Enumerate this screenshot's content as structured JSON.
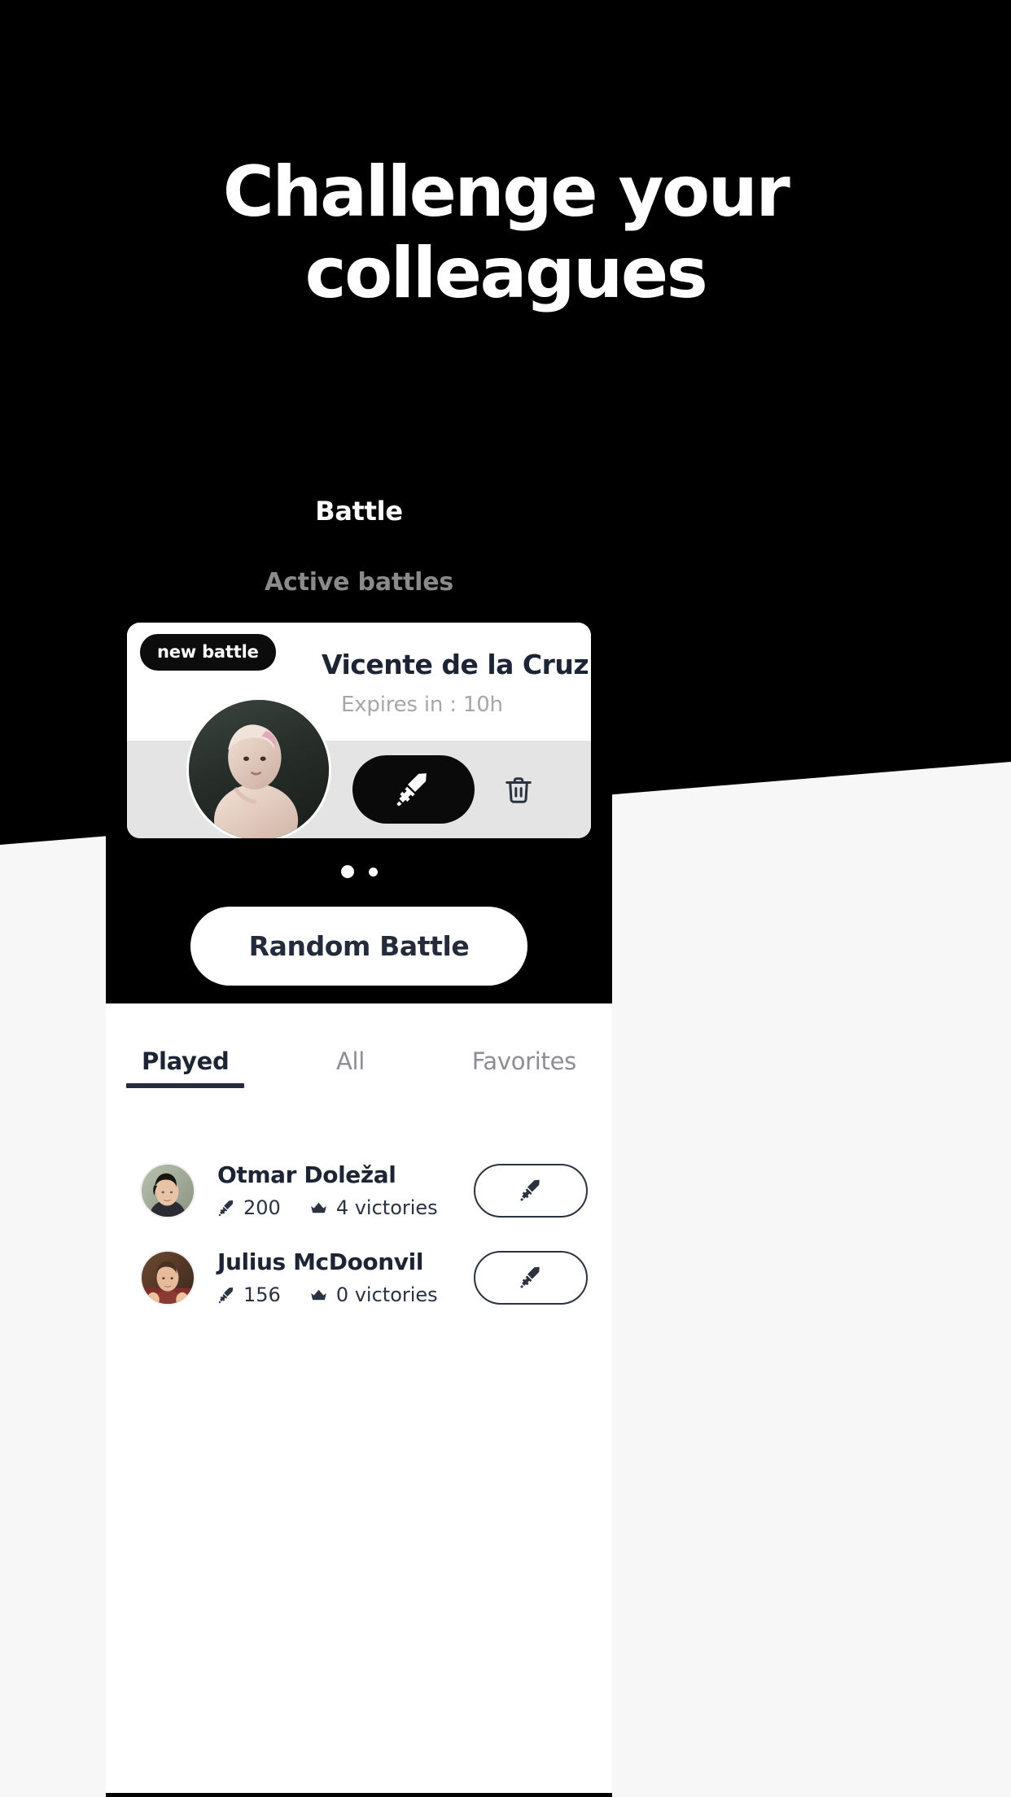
{
  "hero": {
    "line1": "Challenge your",
    "line2": "colleagues"
  },
  "phone": {
    "screen_title": "Battle",
    "section_subtitle": "Active battles",
    "battle_card": {
      "badge": "new battle",
      "name": "Vicente de la Cruz",
      "expires": "Expires in : 10h",
      "fight_icon": "sword-icon",
      "delete_icon": "trash-icon",
      "avatar": "avatar-vicente"
    },
    "pagination": {
      "total": 2,
      "active_index": 0
    },
    "random_battle_label": "Random Battle",
    "tabs": [
      {
        "label": "Played",
        "active": true
      },
      {
        "label": "All",
        "active": false
      },
      {
        "label": "Favorites",
        "active": false
      }
    ],
    "players": [
      {
        "name": "Otmar Doležal",
        "score": "200",
        "victories": "4 victories",
        "score_icon": "sword-icon",
        "victories_icon": "crown-icon",
        "action_icon": "sword-icon"
      },
      {
        "name": "Julius McDoonvil",
        "score": "156",
        "victories": "0 victories",
        "score_icon": "sword-icon",
        "victories_icon": "crown-icon",
        "action_icon": "sword-icon"
      }
    ]
  },
  "colors": {
    "background": "#000000",
    "card_surface": "#ffffff",
    "card_action_bar": "#e4e4e4",
    "accent_dark": "#242c3b",
    "muted_text": "#8a8a8a",
    "expires_text": "#a7a7a7",
    "tab_inactive": "#8d8d96"
  }
}
